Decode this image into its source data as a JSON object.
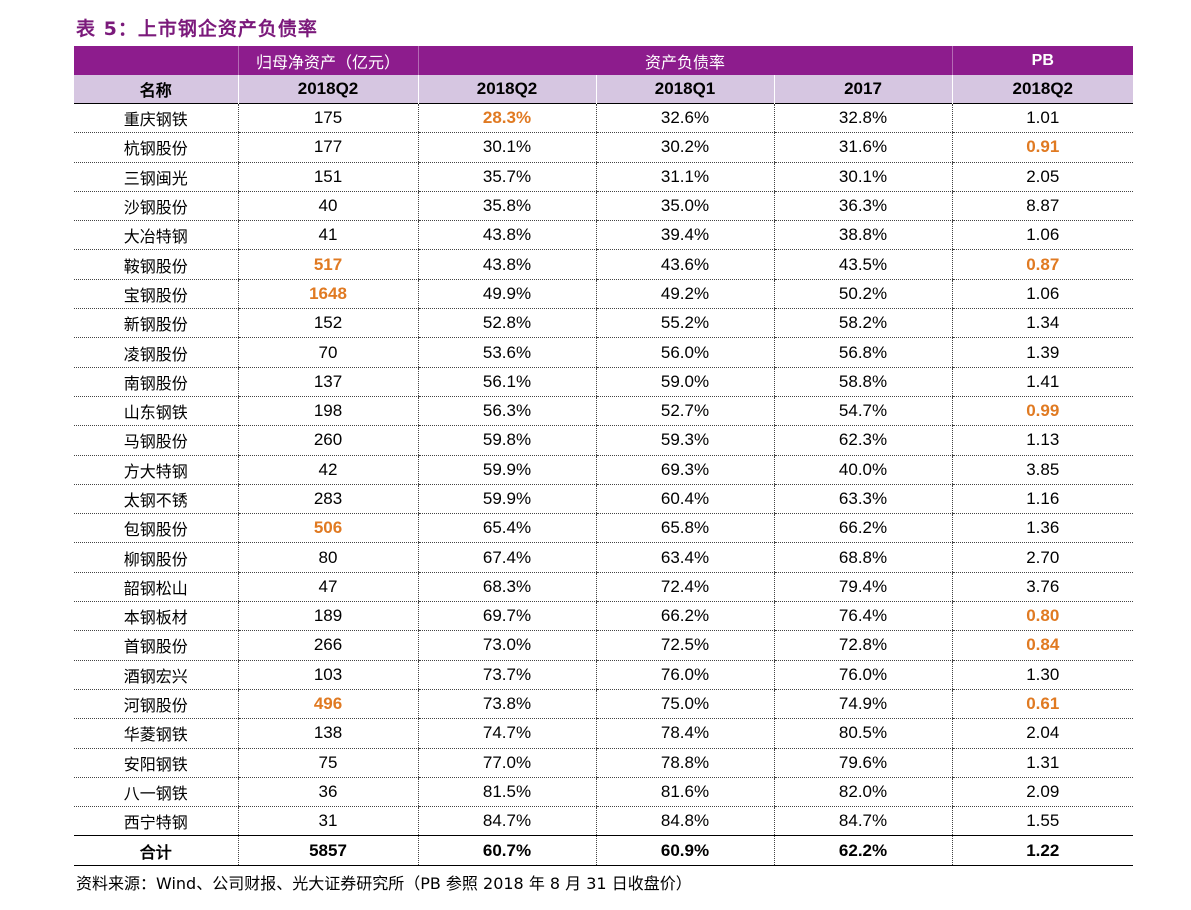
{
  "title": "表 5：上市钢企资产负债率",
  "header_groups": [
    "",
    "归母净资产（亿元）",
    "资产负债率",
    "PB"
  ],
  "sub_headers": [
    "名称",
    "2018Q2",
    "2018Q2",
    "2018Q1",
    "2017",
    "2018Q2"
  ],
  "highlight_color": "#e07a22",
  "rows": [
    {
      "name": "重庆钢铁",
      "equity": "175",
      "d18q2": "28.3%",
      "d18q1": "32.6%",
      "d17": "32.8%",
      "pb": "1.01",
      "hl": [
        "d18q2"
      ]
    },
    {
      "name": "杭钢股份",
      "equity": "177",
      "d18q2": "30.1%",
      "d18q1": "30.2%",
      "d17": "31.6%",
      "pb": "0.91",
      "hl": [
        "pb"
      ]
    },
    {
      "name": "三钢闽光",
      "equity": "151",
      "d18q2": "35.7%",
      "d18q1": "31.1%",
      "d17": "30.1%",
      "pb": "2.05",
      "hl": []
    },
    {
      "name": "沙钢股份",
      "equity": "40",
      "d18q2": "35.8%",
      "d18q1": "35.0%",
      "d17": "36.3%",
      "pb": "8.87",
      "hl": []
    },
    {
      "name": "大冶特钢",
      "equity": "41",
      "d18q2": "43.8%",
      "d18q1": "39.4%",
      "d17": "38.8%",
      "pb": "1.06",
      "hl": []
    },
    {
      "name": "鞍钢股份",
      "equity": "517",
      "d18q2": "43.8%",
      "d18q1": "43.6%",
      "d17": "43.5%",
      "pb": "0.87",
      "hl": [
        "equity",
        "pb"
      ]
    },
    {
      "name": "宝钢股份",
      "equity": "1648",
      "d18q2": "49.9%",
      "d18q1": "49.2%",
      "d17": "50.2%",
      "pb": "1.06",
      "hl": [
        "equity"
      ]
    },
    {
      "name": "新钢股份",
      "equity": "152",
      "d18q2": "52.8%",
      "d18q1": "55.2%",
      "d17": "58.2%",
      "pb": "1.34",
      "hl": []
    },
    {
      "name": "凌钢股份",
      "equity": "70",
      "d18q2": "53.6%",
      "d18q1": "56.0%",
      "d17": "56.8%",
      "pb": "1.39",
      "hl": []
    },
    {
      "name": "南钢股份",
      "equity": "137",
      "d18q2": "56.1%",
      "d18q1": "59.0%",
      "d17": "58.8%",
      "pb": "1.41",
      "hl": []
    },
    {
      "name": "山东钢铁",
      "equity": "198",
      "d18q2": "56.3%",
      "d18q1": "52.7%",
      "d17": "54.7%",
      "pb": "0.99",
      "hl": [
        "pb"
      ]
    },
    {
      "name": "马钢股份",
      "equity": "260",
      "d18q2": "59.8%",
      "d18q1": "59.3%",
      "d17": "62.3%",
      "pb": "1.13",
      "hl": []
    },
    {
      "name": "方大特钢",
      "equity": "42",
      "d18q2": "59.9%",
      "d18q1": "69.3%",
      "d17": "40.0%",
      "pb": "3.85",
      "hl": []
    },
    {
      "name": "太钢不锈",
      "equity": "283",
      "d18q2": "59.9%",
      "d18q1": "60.4%",
      "d17": "63.3%",
      "pb": "1.16",
      "hl": []
    },
    {
      "name": "包钢股份",
      "equity": "506",
      "d18q2": "65.4%",
      "d18q1": "65.8%",
      "d17": "66.2%",
      "pb": "1.36",
      "hl": [
        "equity"
      ]
    },
    {
      "name": "柳钢股份",
      "equity": "80",
      "d18q2": "67.4%",
      "d18q1": "63.4%",
      "d17": "68.8%",
      "pb": "2.70",
      "hl": []
    },
    {
      "name": "韶钢松山",
      "equity": "47",
      "d18q2": "68.3%",
      "d18q1": "72.4%",
      "d17": "79.4%",
      "pb": "3.76",
      "hl": []
    },
    {
      "name": "本钢板材",
      "equity": "189",
      "d18q2": "69.7%",
      "d18q1": "66.2%",
      "d17": "76.4%",
      "pb": "0.80",
      "hl": [
        "pb"
      ]
    },
    {
      "name": "首钢股份",
      "equity": "266",
      "d18q2": "73.0%",
      "d18q1": "72.5%",
      "d17": "72.8%",
      "pb": "0.84",
      "hl": [
        "pb"
      ]
    },
    {
      "name": "酒钢宏兴",
      "equity": "103",
      "d18q2": "73.7%",
      "d18q1": "76.0%",
      "d17": "76.0%",
      "pb": "1.30",
      "hl": []
    },
    {
      "name": "河钢股份",
      "equity": "496",
      "d18q2": "73.8%",
      "d18q1": "75.0%",
      "d17": "74.9%",
      "pb": "0.61",
      "hl": [
        "equity",
        "pb"
      ]
    },
    {
      "name": "华菱钢铁",
      "equity": "138",
      "d18q2": "74.7%",
      "d18q1": "78.4%",
      "d17": "80.5%",
      "pb": "2.04",
      "hl": []
    },
    {
      "name": "安阳钢铁",
      "equity": "75",
      "d18q2": "77.0%",
      "d18q1": "78.8%",
      "d17": "79.6%",
      "pb": "1.31",
      "hl": []
    },
    {
      "name": "八一钢铁",
      "equity": "36",
      "d18q2": "81.5%",
      "d18q1": "81.6%",
      "d17": "82.0%",
      "pb": "2.09",
      "hl": []
    },
    {
      "name": "西宁特钢",
      "equity": "31",
      "d18q2": "84.7%",
      "d18q1": "84.8%",
      "d17": "84.7%",
      "pb": "1.55",
      "hl": []
    }
  ],
  "total": {
    "name": "合计",
    "equity": "5857",
    "d18q2": "60.7%",
    "d18q1": "60.9%",
    "d17": "62.2%",
    "pb": "1.22"
  },
  "source": "资料来源：Wind、公司财报、光大证券研究所（PB 参照 2018 年 8 月 31 日收盘价）"
}
